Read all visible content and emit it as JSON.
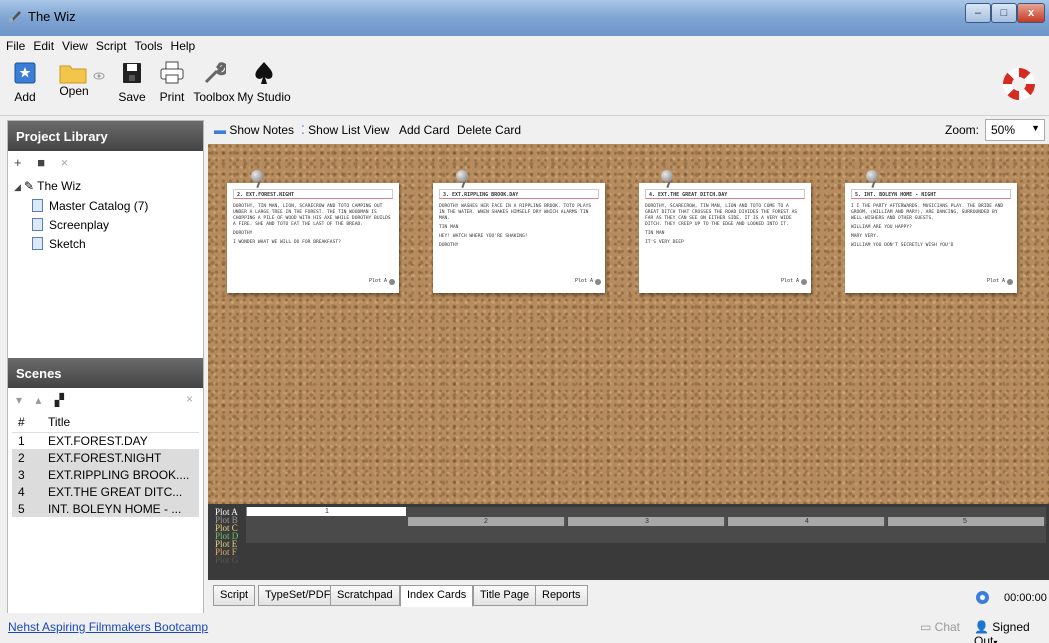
{
  "window": {
    "title": "The Wiz",
    "minimize": "–",
    "maximize": "□",
    "close": "x"
  },
  "menu": [
    "File",
    "Edit",
    "View",
    "Script",
    "Tools",
    "Help"
  ],
  "toolbar": {
    "add": "Add",
    "open": "Open",
    "save": "Save",
    "print": "Print",
    "toolbox": "Toolbox",
    "my_studio": "My Studio"
  },
  "library": {
    "heading": "Project Library",
    "tools": [
      "+",
      "■",
      "×"
    ],
    "root": "The Wiz",
    "items": [
      "Master Catalog (7)",
      "Screenplay",
      "Sketch"
    ]
  },
  "scenes": {
    "heading": "Scenes",
    "columns": [
      "#",
      "Title"
    ],
    "rows": [
      {
        "num": "1",
        "title": "EXT.FOREST.DAY"
      },
      {
        "num": "2",
        "title": "EXT.FOREST.NIGHT"
      },
      {
        "num": "3",
        "title": "EXT.RIPPLING BROOK...."
      },
      {
        "num": "4",
        "title": "EXT.THE GREAT DITC..."
      },
      {
        "num": "5",
        "title": "INT. BOLEYN HOME - ..."
      }
    ]
  },
  "board_toolbar": {
    "show_notes": "Show Notes",
    "show_list": "Show List View",
    "add_card": "Add Card",
    "delete_card": "Delete Card",
    "zoom_label": "Zoom:",
    "zoom_value": "50%"
  },
  "cards": [
    {
      "heading": "2. EXT.FOREST.NIGHT",
      "paras": [
        "DOROTHY, TIN MAN, LION, SCARECROW AND TOTO CAMPING OUT UNDER A LARGE TREE IN THE FOREST. THE TIN WOODMAN IS CHOPPING A PILE OF WOOD WITH HIS AXE WHILE DOROTHY BUILDS A FIRE. SHE AND TOTO EAT THE LAST OF THE BREAD.",
        "DOROTHY",
        "I WONDER WHAT WE WILL DO FOR BREAKFAST?"
      ],
      "plot": "Plot A"
    },
    {
      "heading": "3. EXT.RIPPLING BROOK.DAY",
      "paras": [
        "DOROTHY WASHES HER FACE IN A RIPPLING BROOK. TOTO PLAYS IN THE WATER. WHEN SHAKES HIMSELF DRY WHICH ALARMS TIN MAN.",
        "TIN MAN",
        "HEY! WATCH WHERE YOU'RE SHAKING!",
        "DOROTHY"
      ],
      "plot": "Plot A"
    },
    {
      "heading": "4. EXT.THE GREAT DITCH.DAY",
      "paras": [
        "DOROTHY, SCARECROW, TIN MAN, LION AND TOTO COME TO A GREAT DITCH THAT CROSSES THE ROAD DIVIDES THE FOREST AS FAR AS THEY CAN SEE ON EITHER SIDE. IT IS A VERY WIDE DITCH. THEY CREEP UP TO THE EDGE AND LOOKED INTO IT.",
        "TIN MAN",
        "IT'S VERY DEEP"
      ],
      "plot": "Plot A"
    },
    {
      "heading": "5. INT. BOLEYN HOME - NIGHT",
      "paras": [
        "I I THE PARTY AFTERWARDS. MUSICIANS PLAY. THE BRIDE AND GROOM, (WILLIAM AND MARY), ARE DANCING, SURROUNDED BY WELL-WISHERS AND OTHER GUESTS.",
        "WILLIAM ARE YOU HAPPY?",
        "MARY VERY.",
        "WILLIAM YOU DON'T SECRETLY WISH YOU'D"
      ],
      "plot": "Plot A"
    }
  ],
  "timeline": {
    "plots": [
      "Plot A",
      "Plot B",
      "Plot C",
      "Plot D",
      "Plot E",
      "Plot F",
      "Plot G"
    ],
    "scene_numbers": [
      "1",
      "2",
      "3",
      "4",
      "5"
    ]
  },
  "tabs": [
    "Script",
    "TypeSet/PDF",
    "Scratchpad",
    "Index Cards",
    "Title Page",
    "Reports"
  ],
  "active_tab": "Index Cards",
  "status": {
    "timer": "00:00:00",
    "bootcamp_link": "Nehst Aspiring Filmmakers Bootcamp",
    "chat": "Chat",
    "signed": "Signed Out"
  }
}
